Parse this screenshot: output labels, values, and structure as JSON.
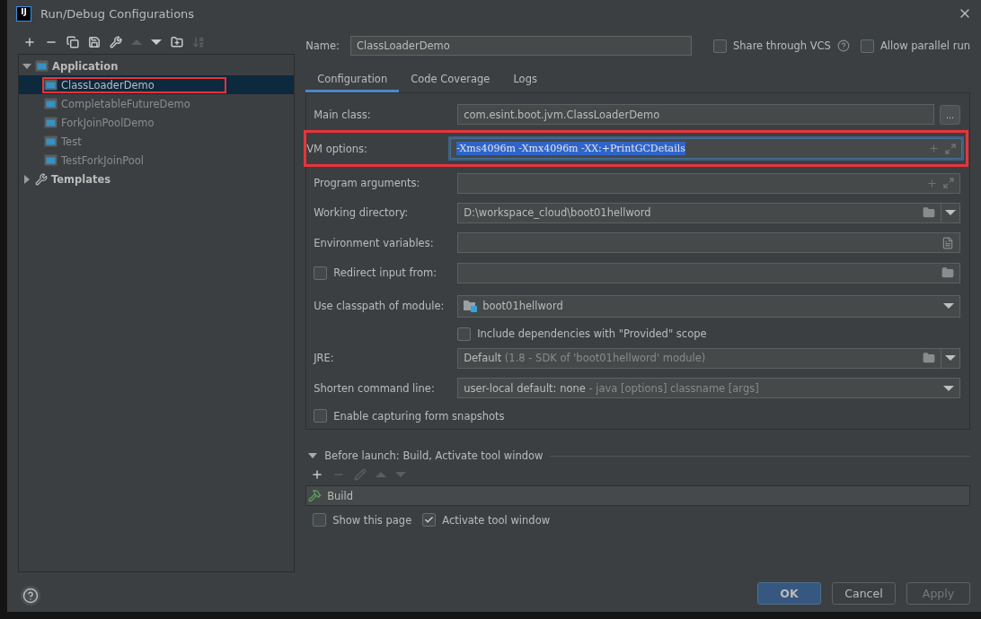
{
  "window": {
    "logo": "IJ",
    "title": "Run/Debug Configurations"
  },
  "toolbar": [
    {
      "kind": "add",
      "disabled": false
    },
    {
      "kind": "remove",
      "disabled": false
    },
    {
      "kind": "copy",
      "disabled": false
    },
    {
      "kind": "save",
      "disabled": false
    },
    {
      "kind": "edit",
      "disabled": false
    },
    {
      "kind": "up",
      "disabled": true
    },
    {
      "kind": "down",
      "disabled": false
    },
    {
      "kind": "folder",
      "disabled": false
    },
    {
      "kind": "sort",
      "disabled": true
    }
  ],
  "tree": [
    {
      "label": "Application",
      "kind": "application",
      "expanded": true,
      "selected": false,
      "children": [
        {
          "label": "ClassLoaderDemo",
          "selected": true,
          "highlighted": true
        },
        {
          "label": "CompletableFutureDemo",
          "selected": false,
          "highlighted": false
        },
        {
          "label": "ForkJoinPoolDemo",
          "selected": false,
          "highlighted": false
        },
        {
          "label": "Test",
          "selected": false,
          "highlighted": false
        },
        {
          "label": "TestForkJoinPool",
          "selected": false,
          "highlighted": false
        }
      ]
    },
    {
      "label": "Templates",
      "kind": "templates",
      "expanded": false,
      "selected": false
    }
  ],
  "name": {
    "label": "Name:",
    "value": "ClassLoaderDemo"
  },
  "options": [
    {
      "label": "Share through VCS",
      "checked": false,
      "help": true
    },
    {
      "label": "Allow parallel run",
      "checked": false
    }
  ],
  "tabs": [
    {
      "label": "Configuration",
      "selected": true
    },
    {
      "label": "Code Coverage",
      "selected": false
    },
    {
      "label": "Logs",
      "selected": false
    }
  ],
  "form": [
    {
      "kind": "class",
      "label": "Main class:",
      "value": "com.esint.boot.jvm.ClassLoaderDemo",
      "button": "..."
    },
    {
      "kind": "options",
      "label": "VM options:",
      "value": "-Xms4096m -Xmx4096m -XX:+PrintGCDetails",
      "selected": true,
      "highlighted": true
    },
    {
      "kind": "options",
      "label": "Program arguments:"
    },
    {
      "kind": "path",
      "label": "Working directory:",
      "value": "D:\\workspace_cloud\\boot01hellword"
    },
    {
      "kind": "env",
      "label": "Environment variables:"
    },
    {
      "kind": "file",
      "label": "Redirect input from:",
      "checked": false
    },
    {
      "kind": "module",
      "label": "Use classpath of module:",
      "value": "boot01hellword"
    },
    {
      "kind": "check",
      "label": "Include dependencies with \"Provided\" scope",
      "checked": false
    },
    {
      "kind": "path",
      "label": "JRE:",
      "value": "Default",
      "hint": " (1.8 - SDK of 'boot01hellword' module)"
    },
    {
      "kind": "combo",
      "label": "Shorten command line:",
      "value": "user-local default: none",
      "hint": " - java [options] classname [args]"
    },
    {
      "kind": "wide-check",
      "label": "Enable capturing form snapshots",
      "checked": false
    }
  ],
  "before_launch": {
    "title": "Before launch: Build, Activate tool window",
    "expanded": true,
    "toolbar": [
      {
        "kind": "add",
        "disabled": false
      },
      {
        "kind": "remove",
        "disabled": true
      },
      {
        "kind": "edit",
        "disabled": true
      },
      {
        "kind": "up",
        "disabled": true
      },
      {
        "kind": "down",
        "disabled": true
      }
    ],
    "tasks": [
      {
        "label": "Build"
      }
    ],
    "checkboxes": [
      {
        "label": "Show this page",
        "checked": false
      },
      {
        "label": "Activate tool window",
        "checked": true
      }
    ]
  },
  "buttons": [
    {
      "label": "OK",
      "kind": "primary",
      "disabled": false
    },
    {
      "label": "Cancel",
      "kind": "normal",
      "disabled": false
    },
    {
      "label": "Apply",
      "kind": "normal",
      "disabled": true
    }
  ]
}
